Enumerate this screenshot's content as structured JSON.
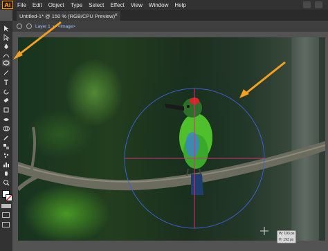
{
  "app": {
    "logo_text": "Ai"
  },
  "menu": {
    "items": [
      "File",
      "Edit",
      "Object",
      "Type",
      "Select",
      "Effect",
      "View",
      "Window",
      "Help"
    ]
  },
  "document": {
    "tab_title": "Untitled-1* @ 150 % (RGB/CPU Preview)",
    "close_glyph": "×"
  },
  "breadcrumb": {
    "layer": "Layer 1",
    "separator": "›",
    "item": "<Image>"
  },
  "tools": [
    {
      "name": "selection-tool-icon"
    },
    {
      "name": "direct-selection-tool-icon"
    },
    {
      "name": "pen-tool-icon"
    },
    {
      "name": "curvature-tool-icon"
    },
    {
      "name": "ellipse-tool-icon",
      "active": true
    },
    {
      "name": "line-segment-tool-icon"
    },
    {
      "name": "type-tool-icon"
    },
    {
      "name": "rotate-tool-icon"
    },
    {
      "name": "eraser-tool-icon"
    },
    {
      "name": "scale-tool-icon"
    },
    {
      "name": "width-tool-icon"
    },
    {
      "name": "shape-builder-tool-icon"
    },
    {
      "name": "eyedropper-tool-icon"
    },
    {
      "name": "blend-tool-icon"
    },
    {
      "name": "symbol-sprayer-tool-icon"
    },
    {
      "name": "column-graph-tool-icon"
    },
    {
      "name": "artboard-tool-icon"
    },
    {
      "name": "hand-tool-icon"
    },
    {
      "name": "zoom-tool-icon"
    }
  ],
  "colors": {
    "fill": "#ffffff",
    "stroke": "#e02020",
    "annotation_arrow": "#f5a020",
    "guide_circle": "#3b5fd6",
    "guide_line": "#d0307a"
  },
  "readout": {
    "width": "W: 193 px",
    "height": "H: 193 px"
  }
}
